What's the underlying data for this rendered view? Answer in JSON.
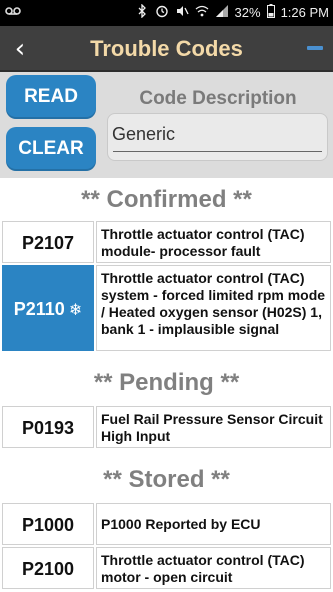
{
  "status_bar": {
    "left_icon": "voicemail-icon",
    "battery_percent": "32%",
    "time": "1:26 PM"
  },
  "header": {
    "title": "Trouble Codes",
    "back_icon": "chevron-left-icon",
    "menu_icon": "minus-icon"
  },
  "controls": {
    "read_label": "READ",
    "clear_label": "CLEAR",
    "code_description_label": "Code Description",
    "code_description_value": "Generic"
  },
  "sections": [
    {
      "title": "** Confirmed **",
      "rows": [
        {
          "code": "P2107",
          "description": "Throttle actuator control (TAC) module- processor fault",
          "selected": false
        },
        {
          "code": "P2110",
          "description": "Throttle actuator control (TAC) system - forced limited rpm mode / Heated oxygen sensor (H02S) 1, bank 1 - implausible signal",
          "selected": true,
          "badge_icon": "snowflake-icon"
        }
      ]
    },
    {
      "title": "** Pending **",
      "rows": [
        {
          "code": "P0193",
          "description": "Fuel Rail Pressure Sensor Circuit High Input",
          "selected": false
        }
      ]
    },
    {
      "title": "** Stored **",
      "rows": [
        {
          "code": "P1000",
          "description": "P1000 Reported by ECU",
          "selected": false
        },
        {
          "code": "P2100",
          "description": "Throttle actuator control (TAC) motor - open circuit",
          "selected": false
        }
      ]
    }
  ],
  "colors": {
    "accent_blue": "#2b84c3",
    "header_bg": "#3f3f3f",
    "title_color": "#f3d9a8"
  }
}
